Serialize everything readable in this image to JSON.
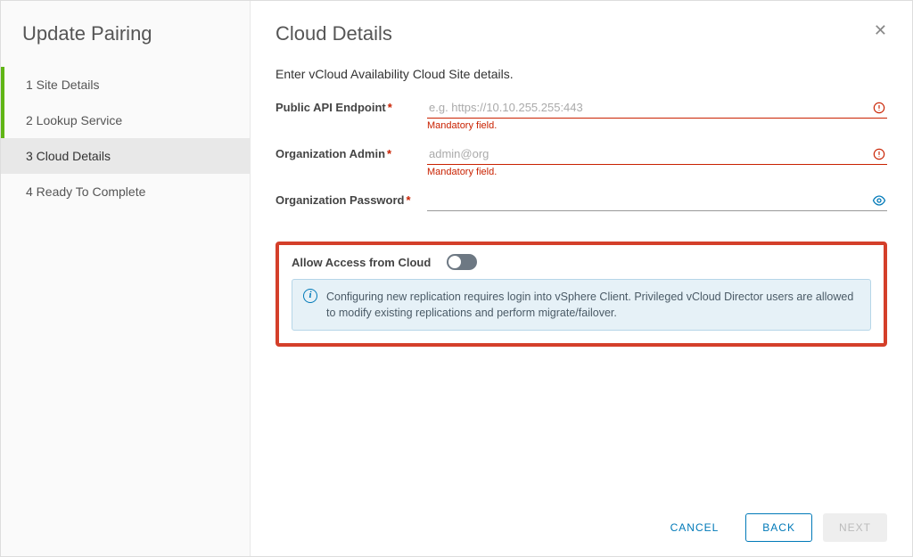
{
  "sidebar": {
    "title": "Update Pairing",
    "steps": [
      {
        "label": "1 Site Details"
      },
      {
        "label": "2 Lookup Service"
      },
      {
        "label": "3 Cloud Details"
      },
      {
        "label": "4 Ready To Complete"
      }
    ]
  },
  "main": {
    "title": "Cloud Details",
    "intro": "Enter vCloud Availability Cloud Site details.",
    "fields": {
      "endpoint": {
        "label": "Public API Endpoint",
        "placeholder": "e.g. https://10.10.255.255:443",
        "value": "",
        "error": "Mandatory field."
      },
      "admin": {
        "label": "Organization Admin",
        "placeholder": "admin@org",
        "value": "",
        "error": "Mandatory field."
      },
      "password": {
        "label": "Organization Password",
        "placeholder": "",
        "value": ""
      }
    },
    "allowAccess": {
      "label": "Allow Access from Cloud",
      "enabled": false
    },
    "infoMessage": "Configuring new replication requires login into vSphere Client. Privileged vCloud Director users are allowed to modify existing replications and perform migrate/failover."
  },
  "footer": {
    "cancel": "CANCEL",
    "back": "BACK",
    "next": "NEXT"
  }
}
